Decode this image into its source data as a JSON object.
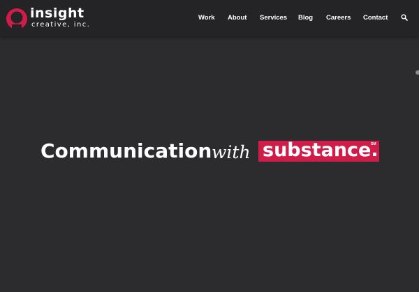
{
  "brand": {
    "name": "insight",
    "tagline": "creative, inc.",
    "accent_color": "#d01c48"
  },
  "nav": {
    "items": [
      {
        "label": "Work"
      },
      {
        "label": "About"
      },
      {
        "label": "Services"
      },
      {
        "label": "Blog"
      },
      {
        "label": "Careers"
      },
      {
        "label": "Contact"
      }
    ],
    "search_icon": "search-icon"
  },
  "hero": {
    "headline_part1": "Communication",
    "headline_part2": "with",
    "headline_highlight": "substance.",
    "service_mark": "SM"
  }
}
